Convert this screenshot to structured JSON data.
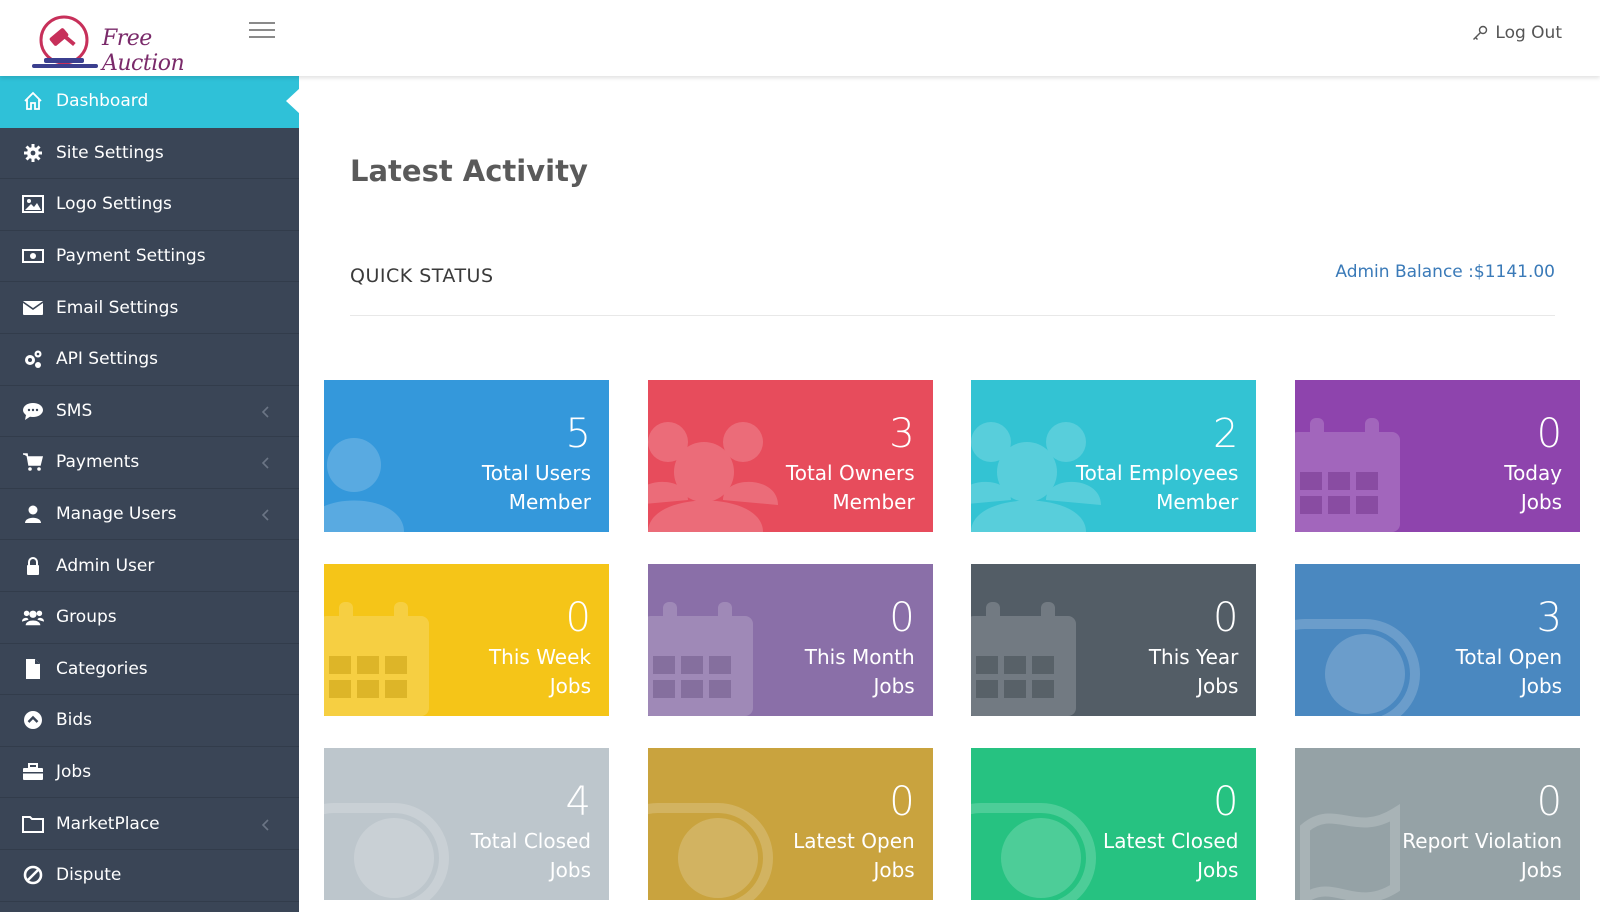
{
  "header": {
    "brand": "Free Auction",
    "logout_label": "Log Out"
  },
  "sidebar": {
    "items": [
      {
        "label": "Dashboard",
        "icon": "home-icon",
        "active": true,
        "submenu": false
      },
      {
        "label": "Site Settings",
        "icon": "gear-icon",
        "active": false,
        "submenu": false
      },
      {
        "label": "Logo Settings",
        "icon": "image-icon",
        "active": false,
        "submenu": false
      },
      {
        "label": "Payment Settings",
        "icon": "money-icon",
        "active": false,
        "submenu": false
      },
      {
        "label": "Email Settings",
        "icon": "envelope-icon",
        "active": false,
        "submenu": false
      },
      {
        "label": "API Settings",
        "icon": "gears-icon",
        "active": false,
        "submenu": false
      },
      {
        "label": "SMS",
        "icon": "comment-icon",
        "active": false,
        "submenu": true
      },
      {
        "label": "Payments",
        "icon": "cart-icon",
        "active": false,
        "submenu": true
      },
      {
        "label": "Manage Users",
        "icon": "user-icon",
        "active": false,
        "submenu": true
      },
      {
        "label": "Admin User",
        "icon": "lock-icon",
        "active": false,
        "submenu": false
      },
      {
        "label": "Groups",
        "icon": "users-icon",
        "active": false,
        "submenu": false
      },
      {
        "label": "Categories",
        "icon": "file-icon",
        "active": false,
        "submenu": false
      },
      {
        "label": "Bids",
        "icon": "chevron-circle-icon",
        "active": false,
        "submenu": false
      },
      {
        "label": "Jobs",
        "icon": "briefcase-icon",
        "active": false,
        "submenu": false
      },
      {
        "label": "MarketPlace",
        "icon": "folder-icon",
        "active": false,
        "submenu": true
      },
      {
        "label": "Dispute",
        "icon": "ban-icon",
        "active": false,
        "submenu": false
      }
    ]
  },
  "main": {
    "title": "Latest Activity",
    "section_title": "QUICK STATUS",
    "admin_balance": "Admin Balance :$1141.00"
  },
  "cards": [
    {
      "value": "5",
      "line1": "Total Users",
      "line2": "Member",
      "color": "#3498db",
      "icon": "user-icon"
    },
    {
      "value": "3",
      "line1": "Total Owners",
      "line2": "Member",
      "color": "#e74c5c",
      "icon": "users-icon"
    },
    {
      "value": "2",
      "line1": "Total Employees",
      "line2": "Member",
      "color": "#33c3d3",
      "icon": "users-icon"
    },
    {
      "value": "0",
      "line1": "Today",
      "line2": "Jobs",
      "color": "#8e44ad",
      "icon": "calendar-icon"
    },
    {
      "value": "0",
      "line1": "This Week",
      "line2": "Jobs",
      "color": "#f5c518",
      "icon": "calendar-icon"
    },
    {
      "value": "0",
      "line1": "This Month",
      "line2": "Jobs",
      "color": "#8a6fa8",
      "icon": "calendar-icon"
    },
    {
      "value": "0",
      "line1": "This Year",
      "line2": "Jobs",
      "color": "#535d66",
      "icon": "calendar-icon"
    },
    {
      "value": "3",
      "line1": "Total Open",
      "line2": "Jobs",
      "color": "#4a88c0",
      "icon": "toggle-icon"
    },
    {
      "value": "4",
      "line1": "Total Closed",
      "line2": "Jobs",
      "color": "#bdc6cc",
      "icon": "toggle-icon"
    },
    {
      "value": "0",
      "line1": "Latest Open",
      "line2": "Jobs",
      "color": "#c9a33e",
      "icon": "toggle-icon"
    },
    {
      "value": "0",
      "line1": "Latest Closed",
      "line2": "Jobs",
      "color": "#26c281",
      "icon": "toggle-icon"
    },
    {
      "value": "0",
      "line1": "Report Violation",
      "line2": "Jobs",
      "color": "#95a2a6",
      "icon": "flag-icon"
    }
  ]
}
